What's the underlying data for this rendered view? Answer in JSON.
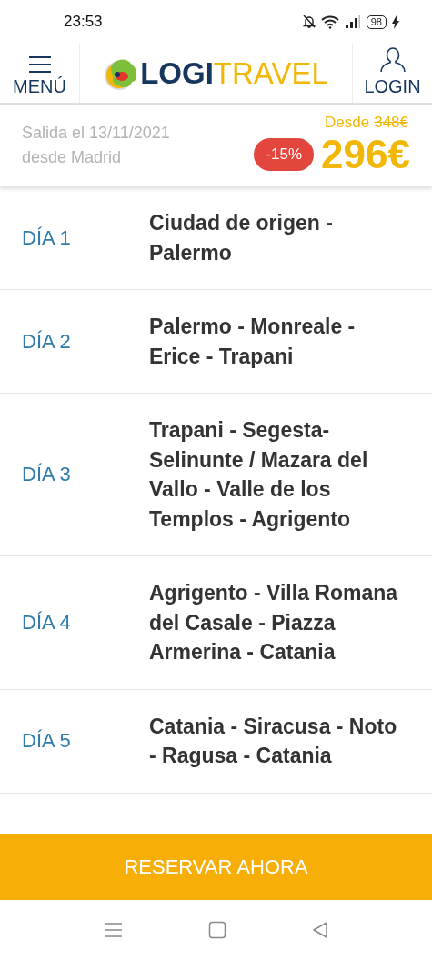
{
  "status_bar": {
    "time": "23:53",
    "battery": "98"
  },
  "header": {
    "menu_label": "MENÚ",
    "logo_bold": "LOGI",
    "logo_light": "TRAVEL",
    "login_label": "LOGIN"
  },
  "price_bar": {
    "departure": "Salida el 13/11/2021",
    "origin": "desde Madrid",
    "from_label": "Desde",
    "old_price": "348€",
    "discount": "-15%",
    "price": "296€"
  },
  "days": [
    {
      "label": "DÍA 1",
      "route": "Ciudad de origen - Palermo"
    },
    {
      "label": "DÍA 2",
      "route": "Palermo - Monreale - Erice - Trapani"
    },
    {
      "label": "DÍA 3",
      "route": "Trapani - Segesta- Selinunte / Mazara del Vallo - Valle de los Templos - Agrigento"
    },
    {
      "label": "DÍA 4",
      "route": "Agrigento - Villa Romana del Casale - Piazza Armerina - Catania"
    },
    {
      "label": "DÍA 5",
      "route": "Catania - Siracusa - Noto - Ragusa - Catania"
    }
  ],
  "book_button": "RESERVAR AHORA"
}
